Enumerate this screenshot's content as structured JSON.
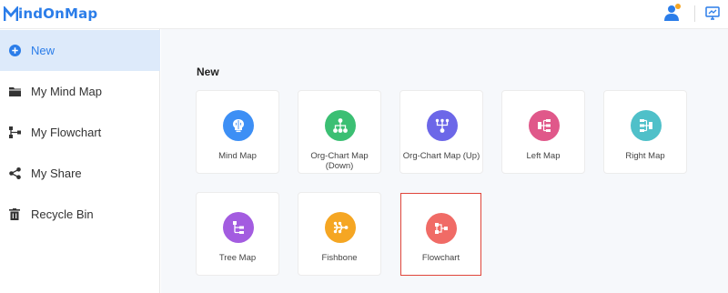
{
  "app": {
    "logo_text": "indOnMap"
  },
  "sidebar": {
    "items": [
      {
        "label": "New",
        "icon": "plus-circle-icon",
        "active": true
      },
      {
        "label": "My Mind Map",
        "icon": "folder-icon",
        "active": false
      },
      {
        "label": "My Flowchart",
        "icon": "flowchart-icon",
        "active": false
      },
      {
        "label": "My Share",
        "icon": "share-icon",
        "active": false
      },
      {
        "label": "Recycle Bin",
        "icon": "trash-icon",
        "active": false
      }
    ]
  },
  "main": {
    "section_title": "New",
    "templates": [
      {
        "label": "Mind Map",
        "icon": "brain-icon",
        "color": "#3d8ff5"
      },
      {
        "label": "Org-Chart Map (Down)",
        "icon": "org-chart-down-icon",
        "color": "#3bbf73"
      },
      {
        "label": "Org-Chart Map (Up)",
        "icon": "org-chart-up-icon",
        "color": "#6c67e8"
      },
      {
        "label": "Left Map",
        "icon": "left-map-icon",
        "color": "#e0588a"
      },
      {
        "label": "Right Map",
        "icon": "right-map-icon",
        "color": "#4fc0c9"
      },
      {
        "label": "Tree Map",
        "icon": "tree-map-icon",
        "color": "#a35ce0"
      },
      {
        "label": "Fishbone",
        "icon": "fishbone-icon",
        "color": "#f5a623"
      },
      {
        "label": "Flowchart",
        "icon": "flowchart-icon",
        "color": "#f06b66",
        "selected": true
      }
    ]
  },
  "colors": {
    "accent": "#2b7de9",
    "selection": "#e0453a",
    "active_bg": "#ddeafa"
  }
}
